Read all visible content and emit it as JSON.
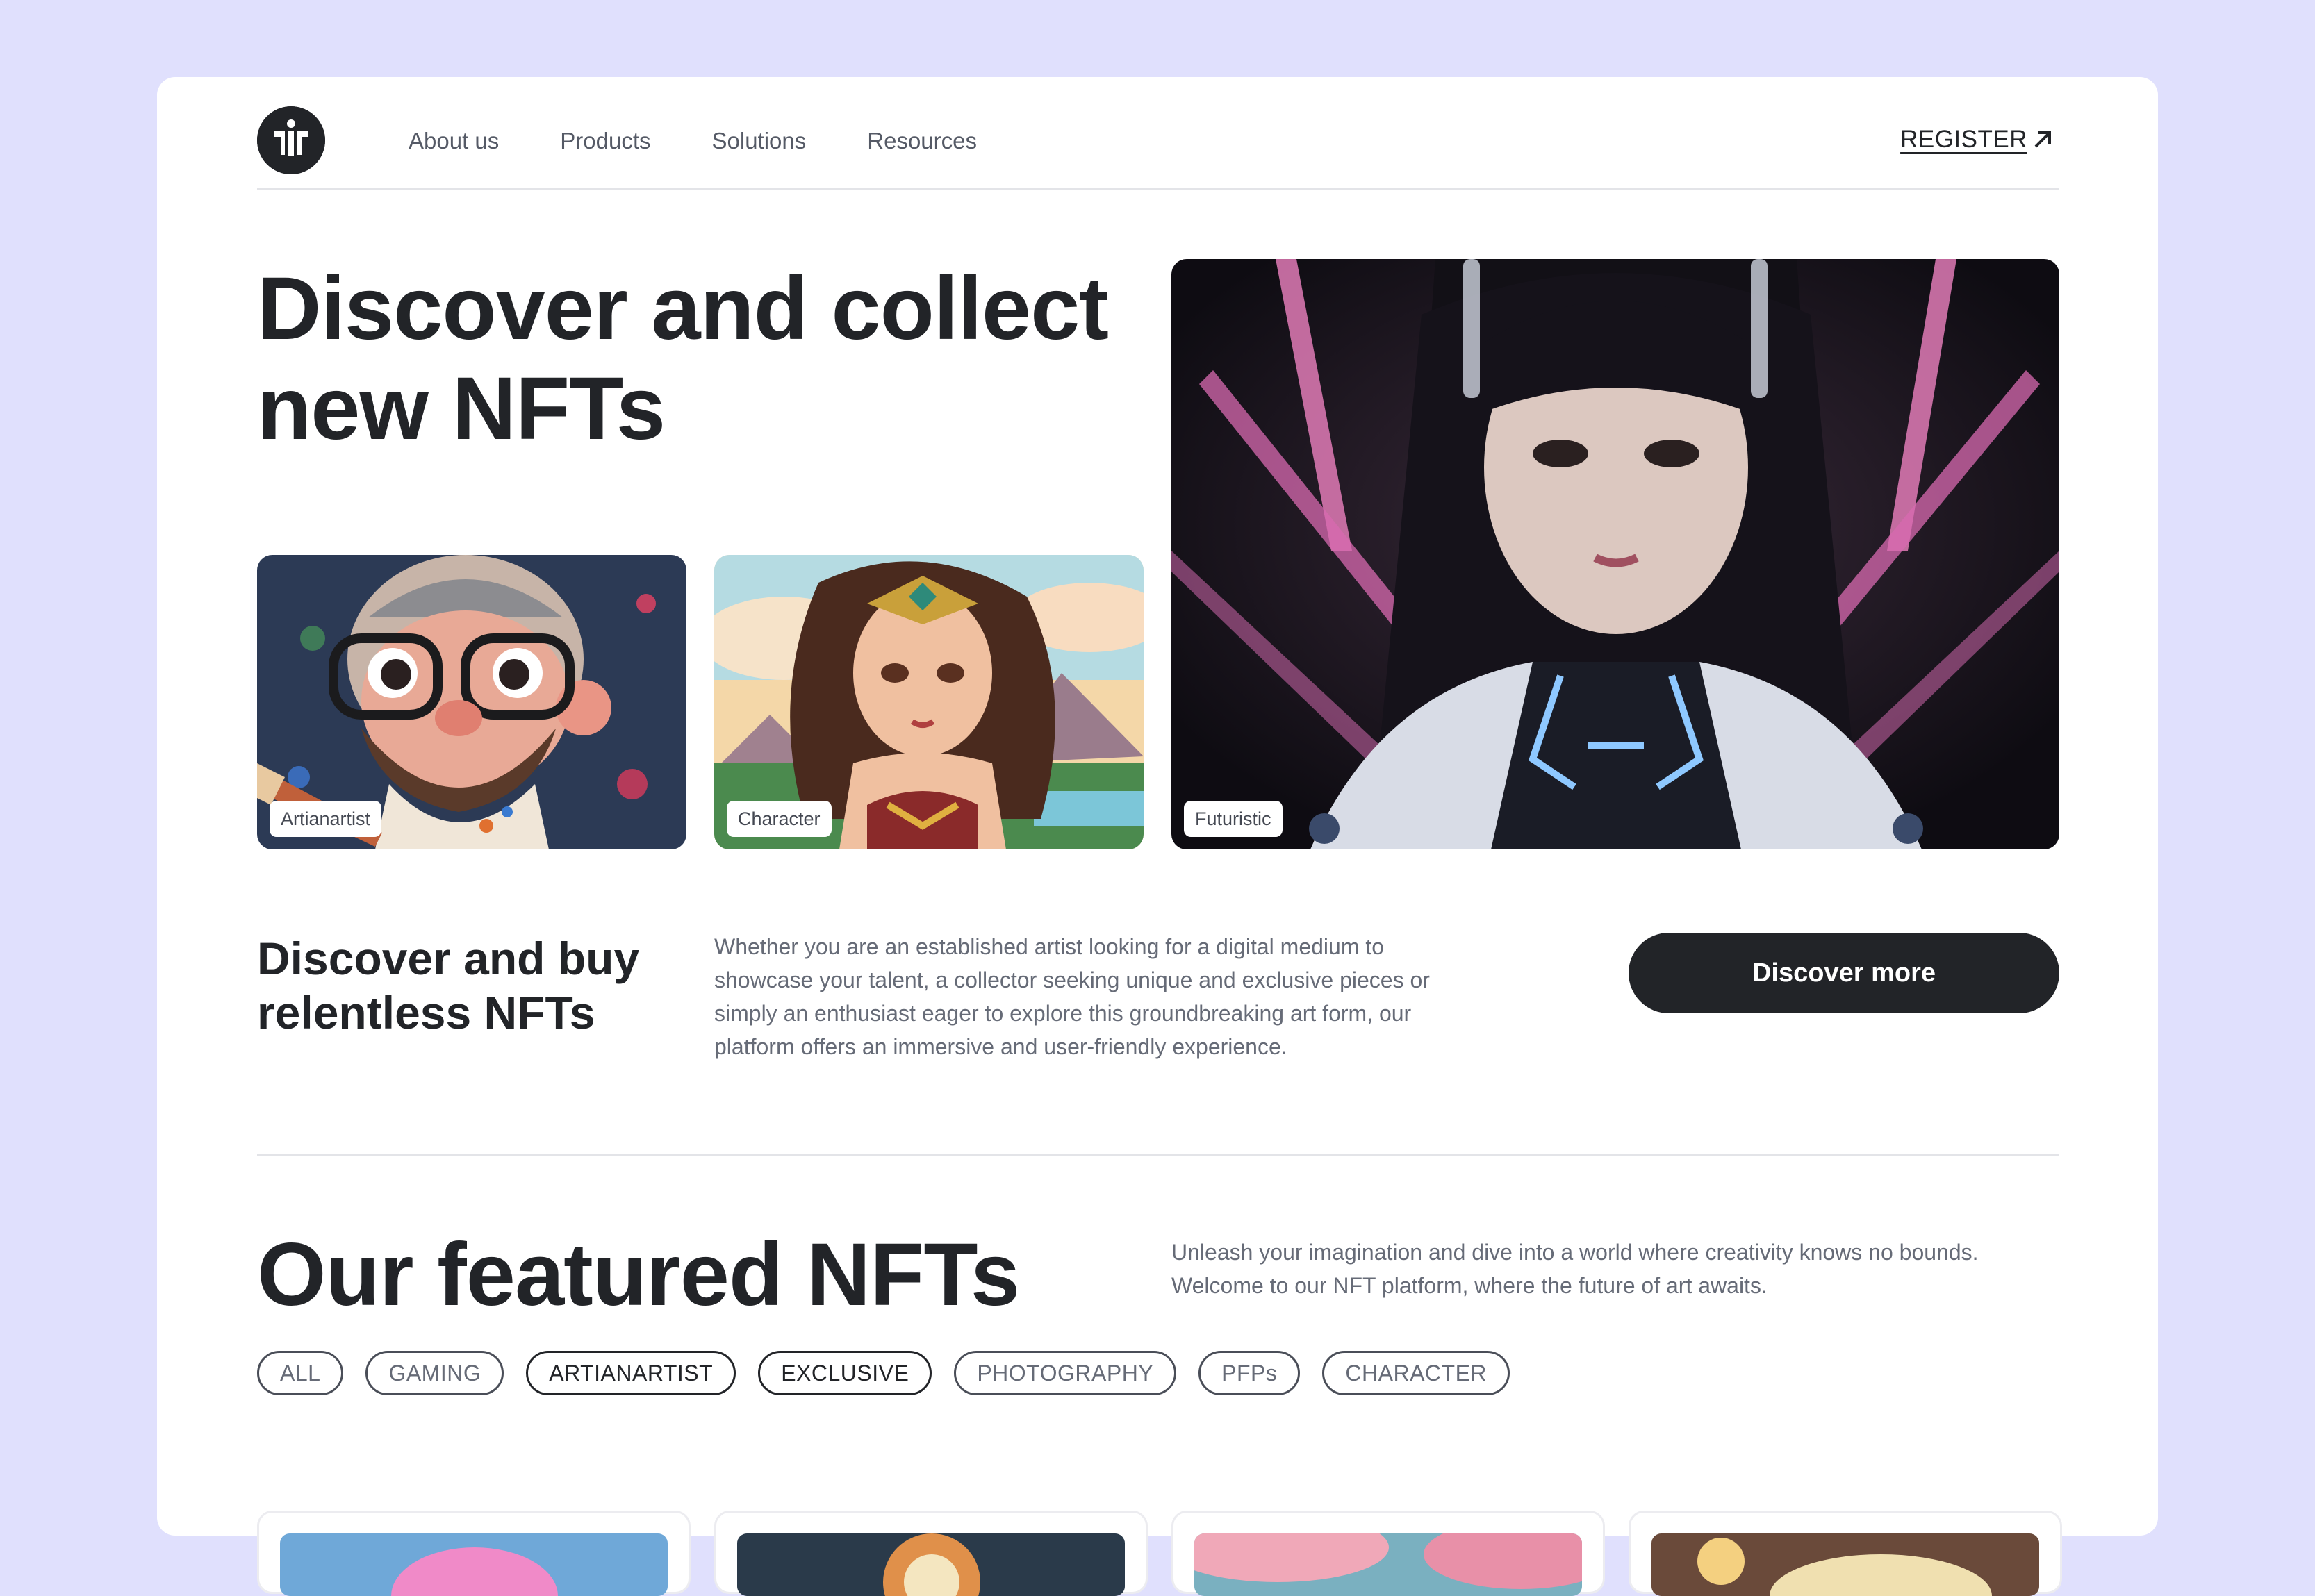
{
  "nav": {
    "links": [
      "About us",
      "Products",
      "Solutions",
      "Resources"
    ],
    "register": "REGISTER"
  },
  "hero": {
    "title_line1": "Discover and collect",
    "title_line2": "new NFTs",
    "tiles": [
      "Artianartist",
      "Character",
      "Futuristic"
    ]
  },
  "intro": {
    "title_line1": "Discover and buy",
    "title_line2": "relentless NFTs",
    "description": "Whether you are an established artist looking for a digital medium to showcase your talent, a collector seeking unique and exclusive pieces or simply an enthusiast eager to explore this groundbreaking art form, our platform offers an immersive and user-friendly experience.",
    "cta": "Discover more"
  },
  "featured": {
    "title": "Our featured NFTs",
    "description": "Unleash your imagination and dive into a world where creativity knows no bounds. Welcome to our NFT platform, where the future of art awaits.",
    "chips": [
      "ALL",
      "GAMING",
      "ARTIANARTIST",
      "EXCLUSIVE",
      "PHOTOGRAPHY",
      "PFPs",
      "CHARACTER"
    ],
    "active_chips": [
      "ARTIANARTIST",
      "EXCLUSIVE"
    ]
  },
  "colors": {
    "background": "#e0e0fd",
    "dark": "#222428",
    "muted": "#666b77"
  },
  "icons": [
    "brand-logo-icon",
    "arrow-up-right-icon"
  ]
}
